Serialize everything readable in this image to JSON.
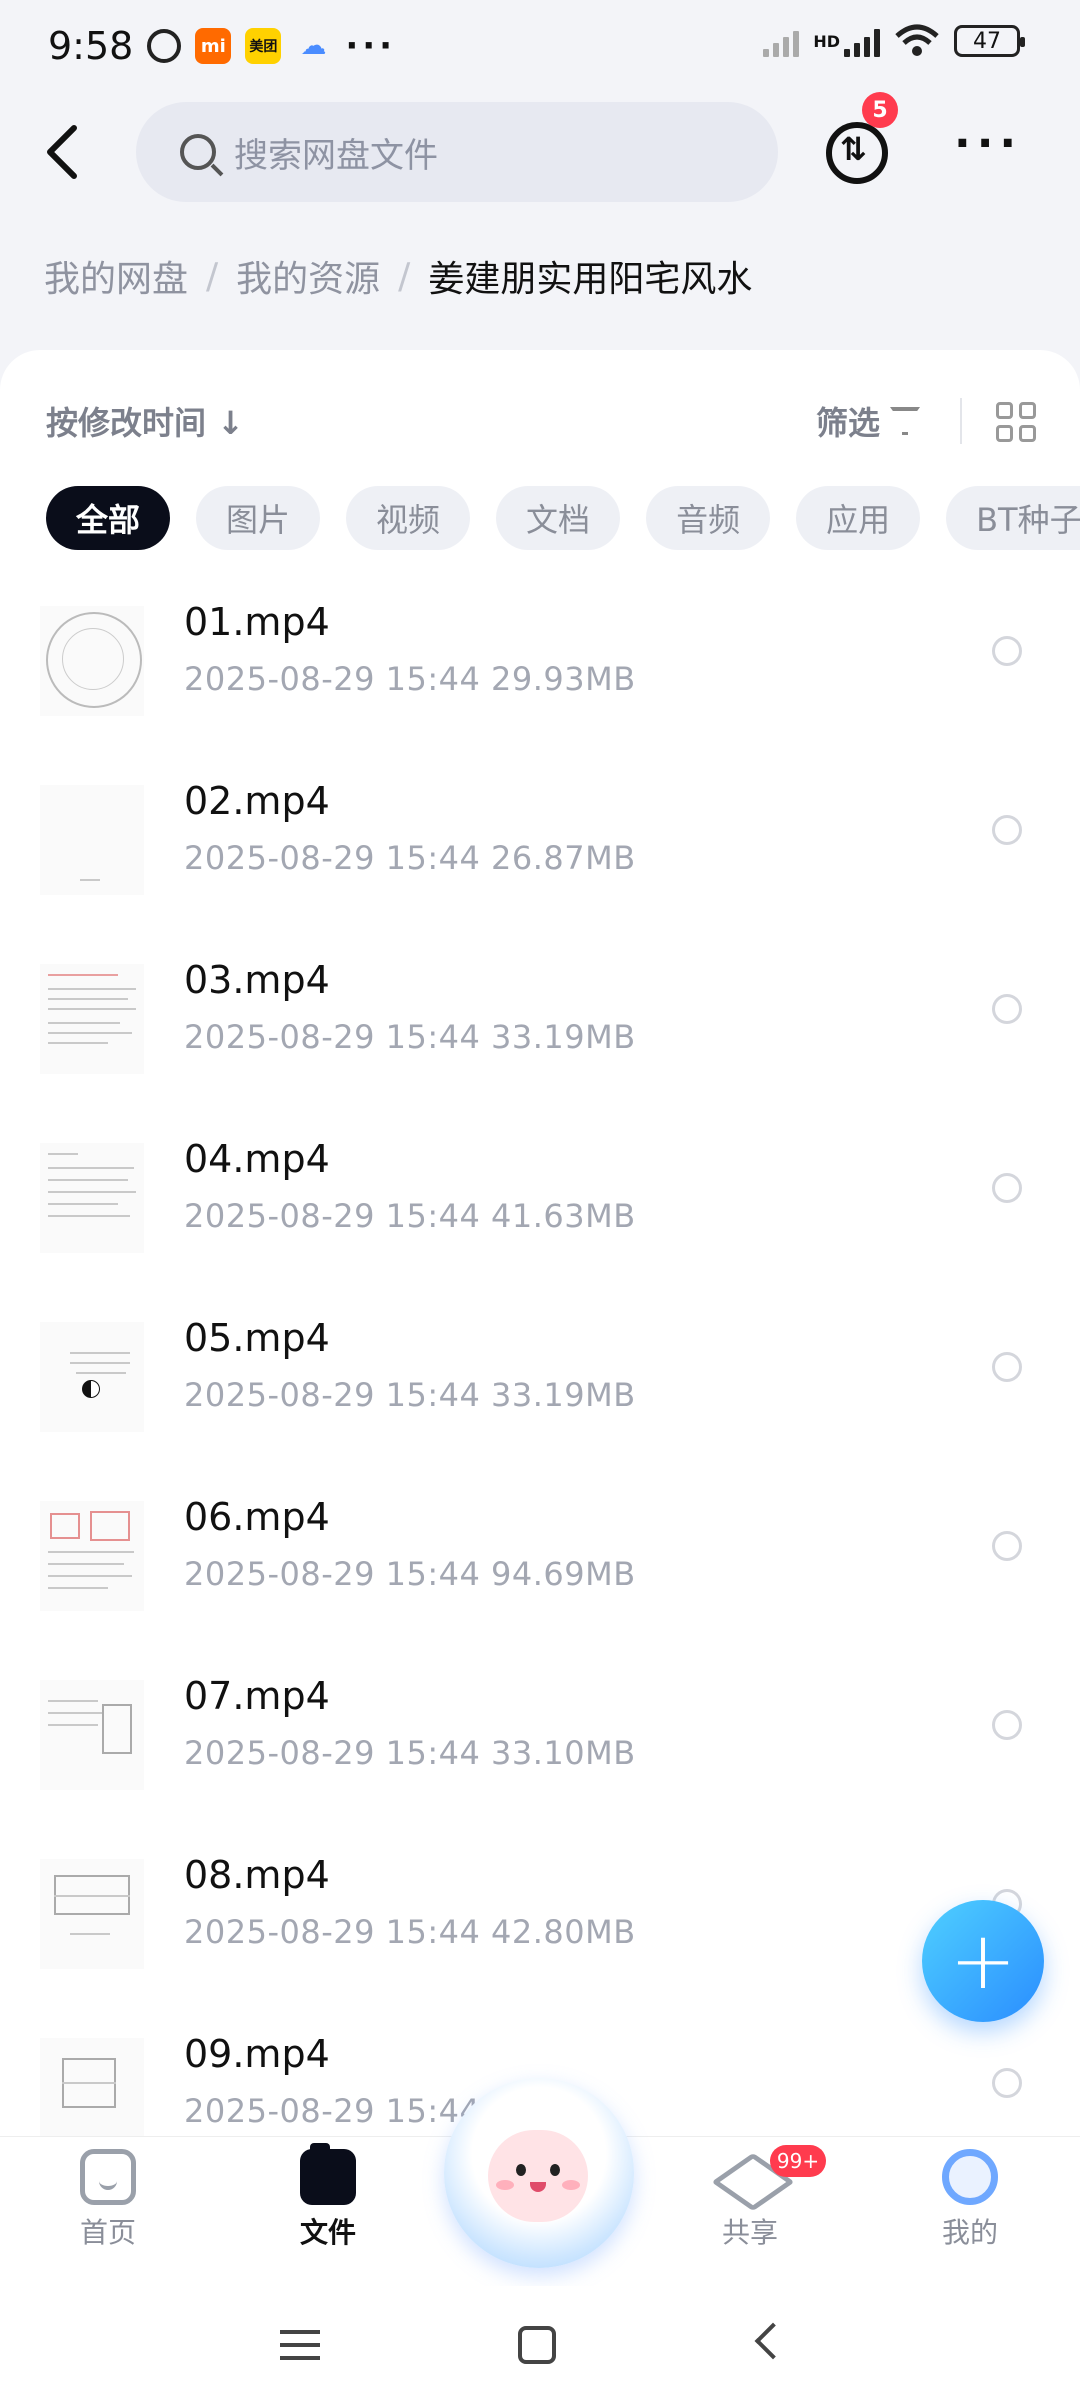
{
  "status_bar": {
    "time": "9:58",
    "mi_label": "mi",
    "meituan_label": "美团",
    "dots": "···",
    "network_label": "HD",
    "battery": "47"
  },
  "header": {
    "search_placeholder": "搜索网盘文件",
    "transfer_badge": "5",
    "transfer_glyph": "⇅",
    "more": "···"
  },
  "breadcrumb": {
    "items": [
      "我的网盘",
      "我的资源"
    ],
    "current": "姜建朋实用阳宅风水",
    "separator": "/"
  },
  "toolbar": {
    "sort_label": "按修改时间 ↓",
    "filter_label": "筛选"
  },
  "chips": [
    {
      "label": "全部",
      "active": true
    },
    {
      "label": "图片",
      "active": false
    },
    {
      "label": "视频",
      "active": false
    },
    {
      "label": "文档",
      "active": false
    },
    {
      "label": "音频",
      "active": false
    },
    {
      "label": "应用",
      "active": false
    },
    {
      "label": "BT种子",
      "active": false
    }
  ],
  "files": [
    {
      "name": "01.mp4",
      "meta": "2025-08-29  15:44  29.93MB"
    },
    {
      "name": "02.mp4",
      "meta": "2025-08-29  15:44  26.87MB"
    },
    {
      "name": "03.mp4",
      "meta": "2025-08-29  15:44  33.19MB"
    },
    {
      "name": "04.mp4",
      "meta": "2025-08-29  15:44  41.63MB"
    },
    {
      "name": "05.mp4",
      "meta": "2025-08-29  15:44  33.19MB"
    },
    {
      "name": "06.mp4",
      "meta": "2025-08-29  15:44  94.69MB"
    },
    {
      "name": "07.mp4",
      "meta": "2025-08-29  15:44  33.10MB"
    },
    {
      "name": "08.mp4",
      "meta": "2025-08-29  15:44  42.80MB"
    },
    {
      "name": "09.mp4",
      "meta": "2025-08-29  15:44"
    }
  ],
  "fab": {
    "label": "+"
  },
  "tabbar": {
    "home": "首页",
    "files": "文件",
    "share": "共享",
    "share_badge": "99+",
    "me": "我的"
  },
  "colors": {
    "accent": "#2a8dff",
    "badge": "#ff3b4e",
    "active_chip": "#0a0d1a"
  }
}
